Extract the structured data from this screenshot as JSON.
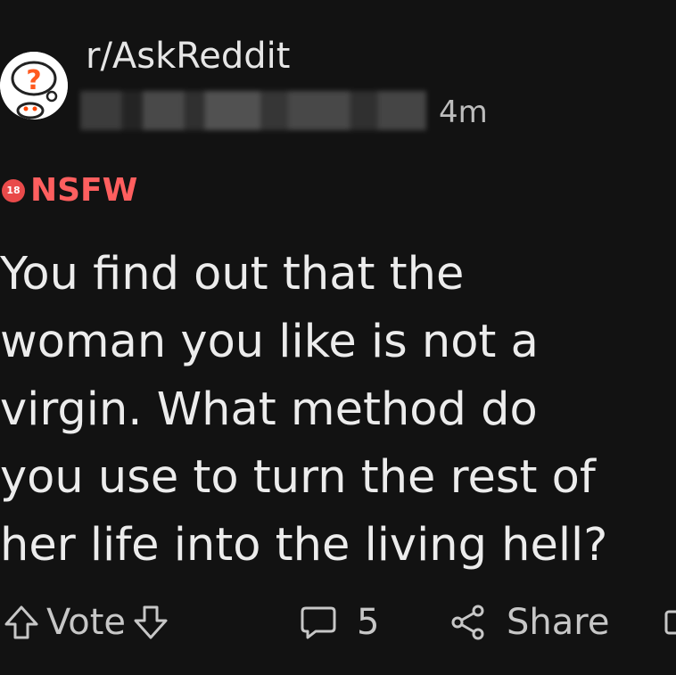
{
  "post": {
    "subreddit": "r/AskReddit",
    "time": "4m",
    "nsfw_badge_icon": "18",
    "nsfw_label": "NSFW",
    "title": "You find out that the\nwoman you like is not a\nvirgin. What method do\nyou use to turn the rest of\nher life into the living hell?"
  },
  "actions": {
    "vote_label": "Vote",
    "comments_count": "5",
    "share_label": "Share"
  },
  "colors": {
    "background": "#121212",
    "nsfw_red": "#ff5f5f",
    "text": "#ececec"
  }
}
